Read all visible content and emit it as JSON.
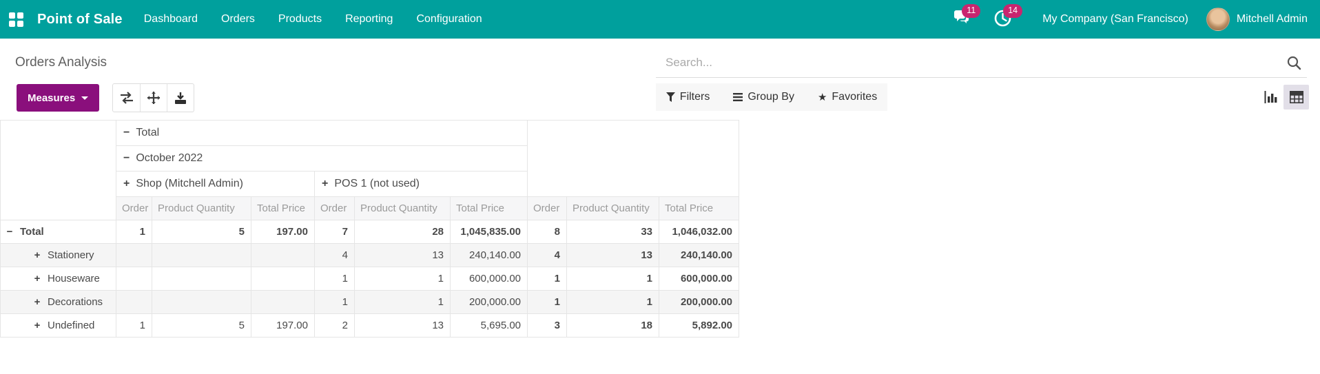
{
  "navbar": {
    "brand": "Point of Sale",
    "menu": [
      "Dashboard",
      "Orders",
      "Products",
      "Reporting",
      "Configuration"
    ],
    "messages_badge": "11",
    "activities_badge": "14",
    "company": "My Company (San Francisco)",
    "user": "Mitchell Admin",
    "colors": {
      "bar": "#00a09d",
      "badge": "#c9256f"
    }
  },
  "page": {
    "title": "Orders Analysis"
  },
  "search": {
    "placeholder": "Search..."
  },
  "toolbar": {
    "measures_label": "Measures",
    "icons": [
      "flip-axis-icon",
      "expand-all-icon",
      "download-icon"
    ],
    "button_color": "#8a0f7c"
  },
  "facets": {
    "filters": "Filters",
    "group_by": "Group By",
    "favorites": "Favorites"
  },
  "view_switcher": [
    "bar-chart-view",
    "pivot-view"
  ],
  "pivot": {
    "col_total_label": "Total",
    "col_month_label": "October 2022",
    "col_groups": [
      "Shop (Mitchell Admin)",
      "POS 1 (not used)"
    ],
    "measures": [
      "Order",
      "Product Quantity",
      "Total Price"
    ],
    "rows": [
      {
        "label": "Total",
        "indent": 0,
        "expander": "minus",
        "bold": true,
        "cells": [
          "1",
          "5",
          "197.00",
          "7",
          "28",
          "1,045,835.00",
          "8",
          "33",
          "1,046,032.00"
        ]
      },
      {
        "label": "Stationery",
        "indent": 1,
        "expander": "plus",
        "bold": false,
        "cells": [
          "",
          "",
          "",
          "4",
          "13",
          "240,140.00",
          "4",
          "13",
          "240,140.00"
        ]
      },
      {
        "label": "Houseware",
        "indent": 1,
        "expander": "plus",
        "bold": false,
        "cells": [
          "",
          "",
          "",
          "1",
          "1",
          "600,000.00",
          "1",
          "1",
          "600,000.00"
        ]
      },
      {
        "label": "Decorations",
        "indent": 1,
        "expander": "plus",
        "bold": false,
        "cells": [
          "",
          "",
          "",
          "1",
          "1",
          "200,000.00",
          "1",
          "1",
          "200,000.00"
        ]
      },
      {
        "label": "Undefined",
        "indent": 1,
        "expander": "plus",
        "bold": false,
        "cells": [
          "1",
          "5",
          "197.00",
          "2",
          "13",
          "5,695.00",
          "3",
          "18",
          "5,892.00"
        ]
      }
    ]
  }
}
